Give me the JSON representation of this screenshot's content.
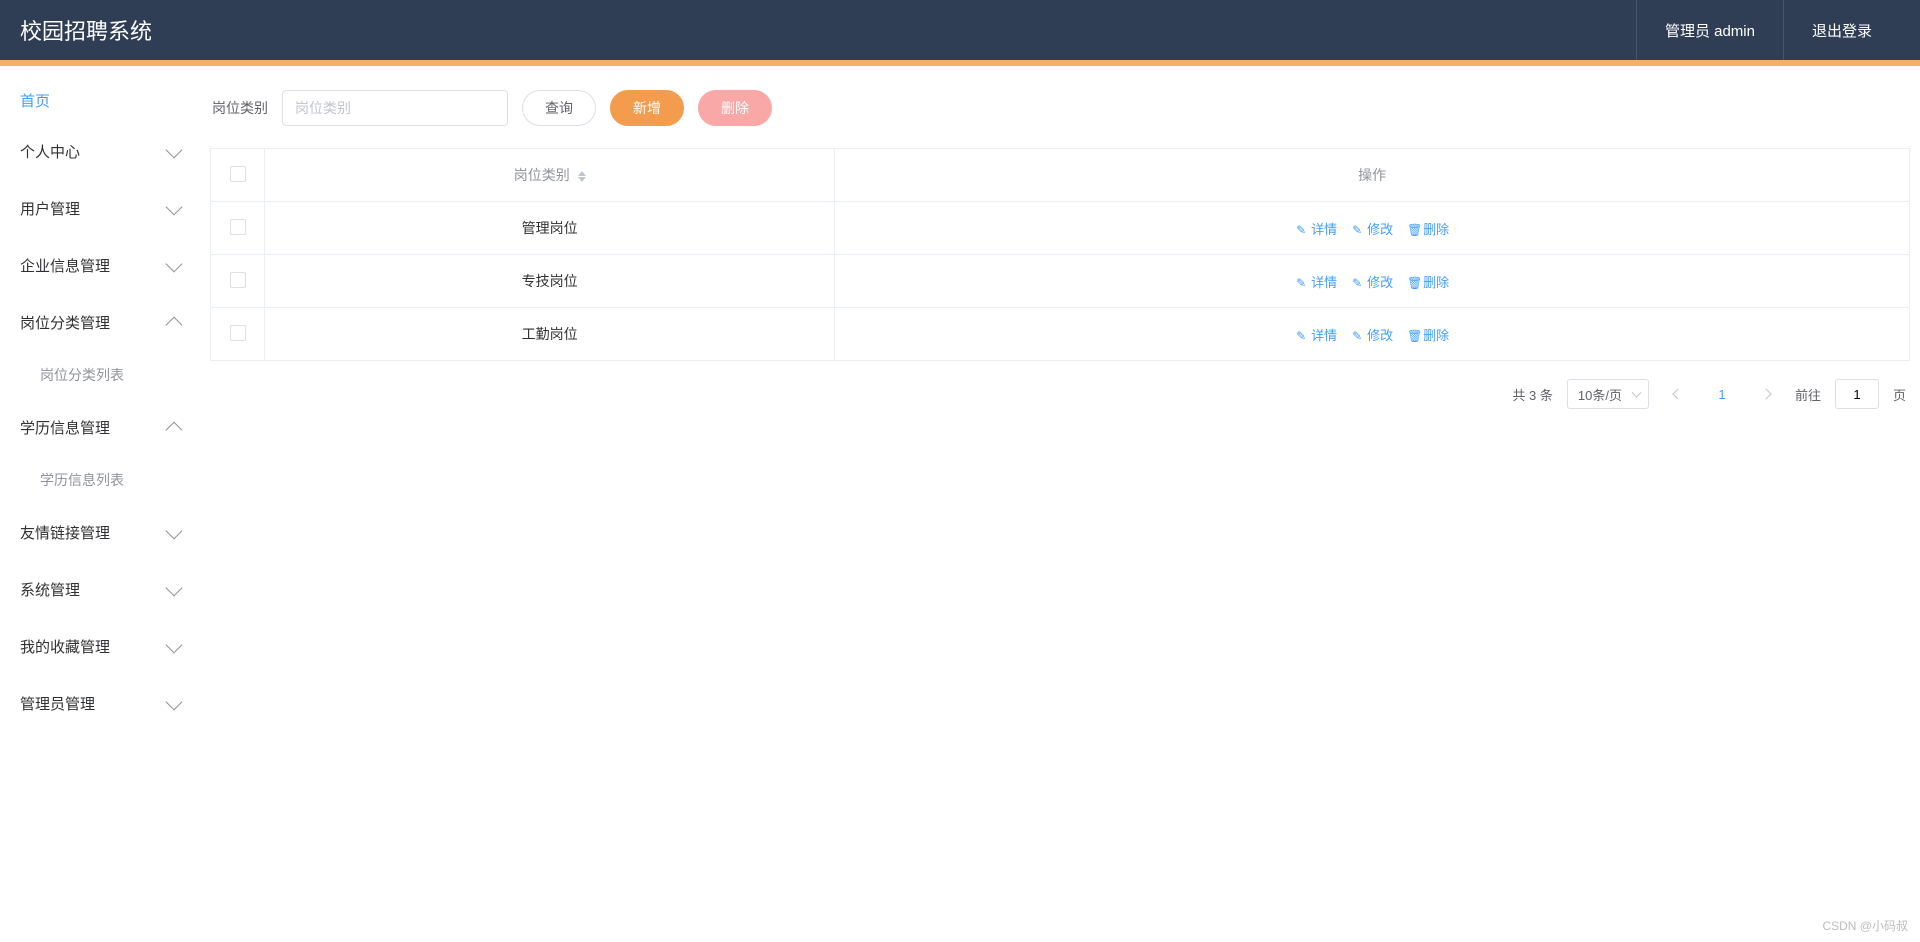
{
  "header": {
    "title": "校园招聘系统",
    "admin_label": "管理员 admin",
    "logout_label": "退出登录"
  },
  "sidebar": {
    "home_label": "首页",
    "items": [
      {
        "label": "个人中心",
        "expanded": false,
        "children": []
      },
      {
        "label": "用户管理",
        "expanded": false,
        "children": []
      },
      {
        "label": "企业信息管理",
        "expanded": false,
        "children": []
      },
      {
        "label": "岗位分类管理",
        "expanded": true,
        "children": [
          {
            "label": "岗位分类列表"
          }
        ]
      },
      {
        "label": "学历信息管理",
        "expanded": true,
        "children": [
          {
            "label": "学历信息列表"
          }
        ]
      },
      {
        "label": "友情链接管理",
        "expanded": false,
        "children": []
      },
      {
        "label": "系统管理",
        "expanded": false,
        "children": []
      },
      {
        "label": "我的收藏管理",
        "expanded": false,
        "children": []
      },
      {
        "label": "管理员管理",
        "expanded": false,
        "children": []
      }
    ]
  },
  "toolbar": {
    "filter_label": "岗位类别",
    "filter_placeholder": "岗位类别",
    "search_label": "查询",
    "add_label": "新增",
    "delete_label": "删除"
  },
  "table": {
    "columns": {
      "category": "岗位类别",
      "actions": "操作"
    },
    "action_labels": {
      "detail": "详情",
      "edit": "修改",
      "delete": "删除"
    },
    "rows": [
      {
        "category": "管理岗位"
      },
      {
        "category": "专技岗位"
      },
      {
        "category": "工勤岗位"
      }
    ]
  },
  "pagination": {
    "total_text": "共 3 条",
    "page_size_label": "10条/页",
    "current_page": "1",
    "goto_prefix": "前往",
    "goto_value": "1",
    "goto_suffix": "页"
  },
  "watermark": "CSDN @小码叔"
}
